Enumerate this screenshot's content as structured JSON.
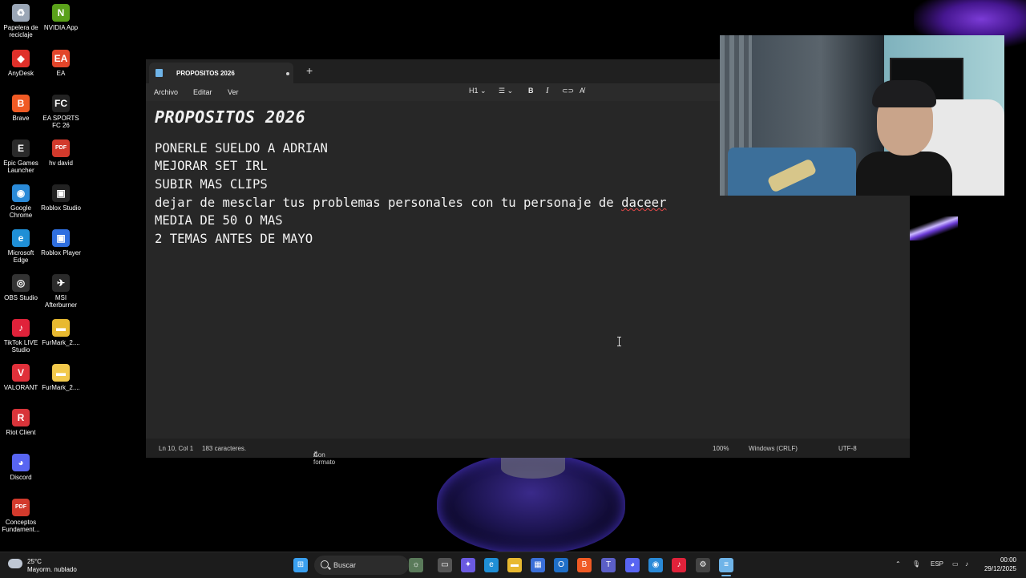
{
  "desktop": {
    "icons": [
      {
        "label": "Papelera de reciclaje",
        "icon": "recycle-bin-icon",
        "color": "#9aa6b6",
        "glyph": "♻"
      },
      {
        "label": "NVIDIA App",
        "icon": "nvidia-icon",
        "color": "#5aa11a",
        "glyph": "N"
      },
      {
        "label": "AnyDesk",
        "icon": "anydesk-icon",
        "color": "#e0302a",
        "glyph": "◆"
      },
      {
        "label": "EA",
        "icon": "ea-icon",
        "color": "#e2452a",
        "glyph": "EA"
      },
      {
        "label": "Brave",
        "icon": "brave-icon",
        "color": "#f05a24",
        "glyph": "B"
      },
      {
        "label": "EA SPORTS FC 26",
        "icon": "ea-sports-fc-icon",
        "color": "#222222",
        "glyph": "FC"
      },
      {
        "label": "Epic Games Launcher",
        "icon": "epic-games-icon",
        "color": "#2a2a2a",
        "glyph": "E"
      },
      {
        "label": "hv david",
        "icon": "pdf-file-icon",
        "color": "#d23a2c",
        "glyph": "PDF"
      },
      {
        "label": "Google Chrome",
        "icon": "chrome-icon",
        "color": "#2a8ad8",
        "glyph": "◉"
      },
      {
        "label": "Roblox Studio",
        "icon": "roblox-studio-icon",
        "color": "#222222",
        "glyph": "▣"
      },
      {
        "label": "Microsoft Edge",
        "icon": "edge-icon",
        "color": "#1f8fd6",
        "glyph": "e"
      },
      {
        "label": "Roblox Player",
        "icon": "roblox-player-icon",
        "color": "#2f6fe0",
        "glyph": "▣"
      },
      {
        "label": "OBS Studio",
        "icon": "obs-icon",
        "color": "#333333",
        "glyph": "◎"
      },
      {
        "label": "MSI Afterburner",
        "icon": "msi-afterburner-icon",
        "color": "#2a2a2a",
        "glyph": "✈"
      },
      {
        "label": "TikTok LIVE Studio",
        "icon": "tiktok-live-icon",
        "color": "#e0223a",
        "glyph": "♪"
      },
      {
        "label": "FurMark_2....",
        "icon": "folder-icon",
        "color": "#e8b930",
        "glyph": "▬"
      },
      {
        "label": "VALORANT",
        "icon": "valorant-icon",
        "color": "#e0303a",
        "glyph": "V"
      },
      {
        "label": "FurMark_2....",
        "icon": "folder-icon",
        "color": "#f2c94c",
        "glyph": "▬"
      },
      {
        "label": "Riot Client",
        "icon": "riot-client-icon",
        "color": "#d8343a",
        "glyph": "R"
      },
      {
        "label": "Discord",
        "icon": "discord-icon",
        "color": "#5865f2",
        "glyph": "◕"
      },
      {
        "label": "Conceptos Fundament...",
        "icon": "pdf-file-icon",
        "color": "#d23a2c",
        "glyph": "PDF"
      }
    ]
  },
  "notepad": {
    "tab_title": "PROPOSITOS 2026",
    "new_tab": "+",
    "menu": {
      "file": "Archivo",
      "edit": "Editar",
      "view": "Ver"
    },
    "format": {
      "heading": "H1",
      "bold": "B",
      "italic": "I"
    },
    "doc_title": "PROPOSITOS 2026",
    "lines": [
      "PONERLE SUELDO A ADRIAN",
      "MEJORAR SET IRL",
      "SUBIR MAS CLIPS",
      "dejar de mesclar tus problemas personales con tu personaje de daceer",
      "MEDIA DE 50 O MAS",
      "2 TEMAS ANTES DE MAYO"
    ],
    "status": {
      "position": "Ln 10, Col 1",
      "chars": "183 caracteres.",
      "format": "Con formato",
      "zoom": "100%",
      "line_ending": "Windows (CRLF)",
      "encoding": "UTF-8"
    }
  },
  "taskbar": {
    "weather_temp": "25°C",
    "weather_desc": "Mayorm. nublado",
    "search_label": "Buscar",
    "language": "ESP",
    "time": "00:00",
    "date": "29/12/2025",
    "apps": [
      {
        "name": "start-icon",
        "color": "#3aa0f0",
        "glyph": "⊞"
      },
      {
        "name": "widgets-icon",
        "color": "#5a7a5a",
        "glyph": "☼"
      },
      {
        "name": "task-view-icon",
        "color": "#555555",
        "glyph": "▭"
      },
      {
        "name": "copilot-icon",
        "color": "#6a5ae0",
        "glyph": "✦"
      },
      {
        "name": "edge-icon",
        "color": "#1f8fd6",
        "glyph": "e"
      },
      {
        "name": "file-explorer-icon",
        "color": "#e8b930",
        "glyph": "▬"
      },
      {
        "name": "store-icon",
        "color": "#3a6fd8",
        "glyph": "▦"
      },
      {
        "name": "outlook-icon",
        "color": "#1f6fc8",
        "glyph": "O"
      },
      {
        "name": "brave-icon",
        "color": "#f05a24",
        "glyph": "B"
      },
      {
        "name": "teams-icon",
        "color": "#5b5fc7",
        "glyph": "T"
      },
      {
        "name": "discord-icon",
        "color": "#5865f2",
        "glyph": "◕"
      },
      {
        "name": "chrome-icon",
        "color": "#2a8ad8",
        "glyph": "◉"
      },
      {
        "name": "tiktok-icon",
        "color": "#e0223a",
        "glyph": "♪"
      },
      {
        "name": "settings-icon",
        "color": "#444444",
        "glyph": "⚙"
      },
      {
        "name": "notepad-icon",
        "color": "#6fb4e8",
        "glyph": "≡"
      }
    ]
  }
}
